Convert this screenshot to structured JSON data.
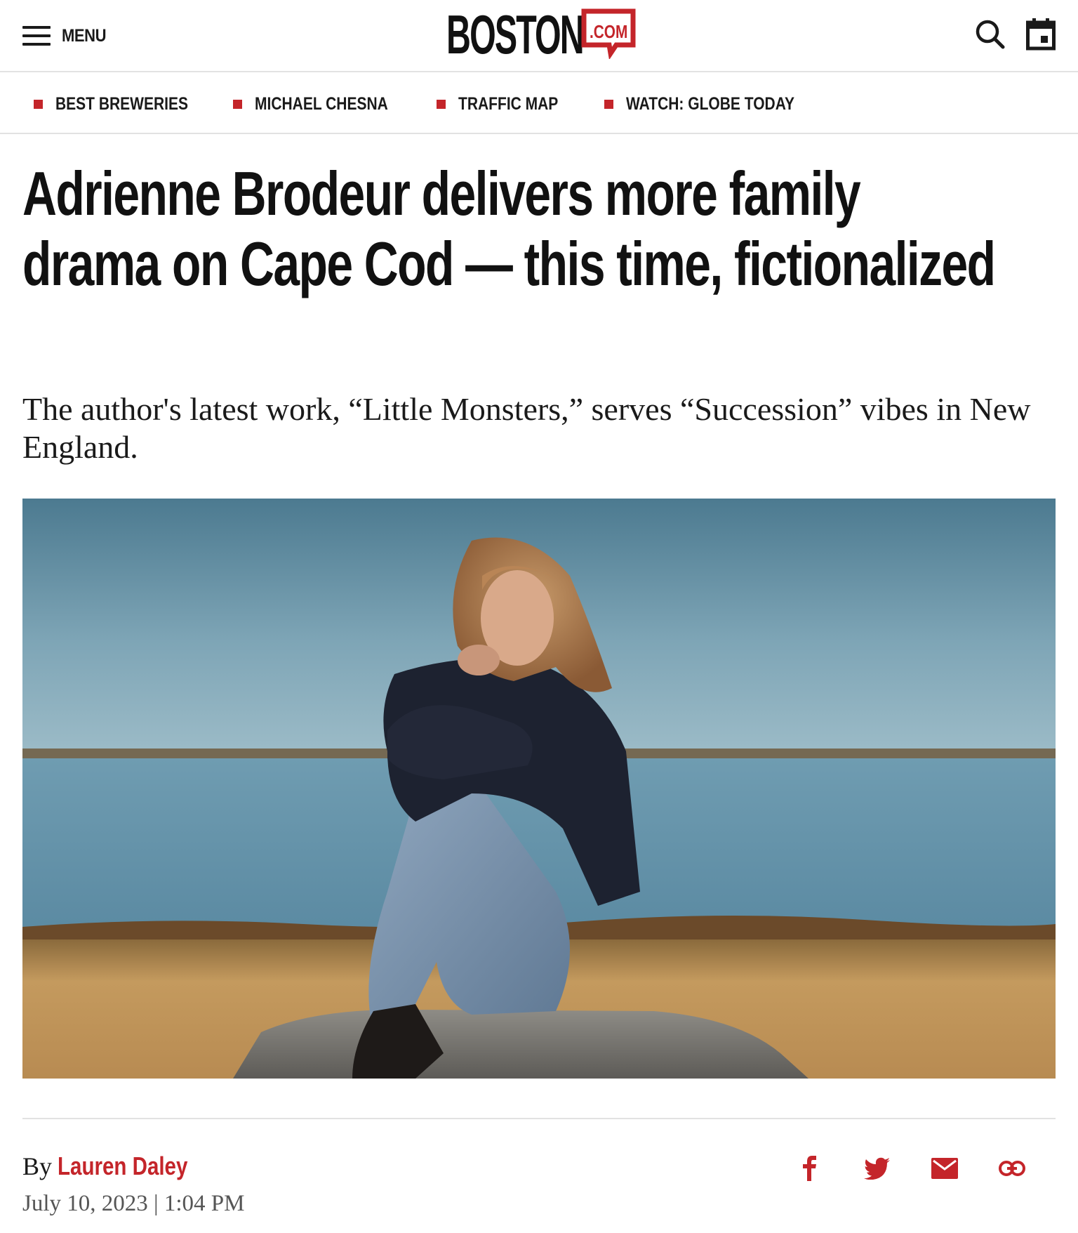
{
  "header": {
    "menu_label": "MENU",
    "logo_text": "BOSTON",
    "logo_suffix": ".COM",
    "icons": {
      "menu": "hamburger-icon",
      "search": "search-icon",
      "calendar": "calendar-icon"
    },
    "brand_color": "#c4252a"
  },
  "trending": [
    {
      "label": "BEST BREWERIES"
    },
    {
      "label": "MICHAEL CHESNA"
    },
    {
      "label": "TRAFFIC MAP"
    },
    {
      "label": "WATCH: GLOBE TODAY"
    }
  ],
  "article": {
    "headline": "Adrienne Brodeur delivers more family drama on Cape Cod — this time, fictionalized",
    "dek": "The author's latest work, “Little Monsters,” serves “Succession” vibes in New England.",
    "byline_prefix": "By",
    "author": "Lauren Daley",
    "date": "July 10, 2023 | 1:04 PM"
  },
  "share": {
    "icons": [
      "facebook-icon",
      "twitter-icon",
      "email-icon",
      "link-icon"
    ],
    "color": "#c4252a"
  }
}
